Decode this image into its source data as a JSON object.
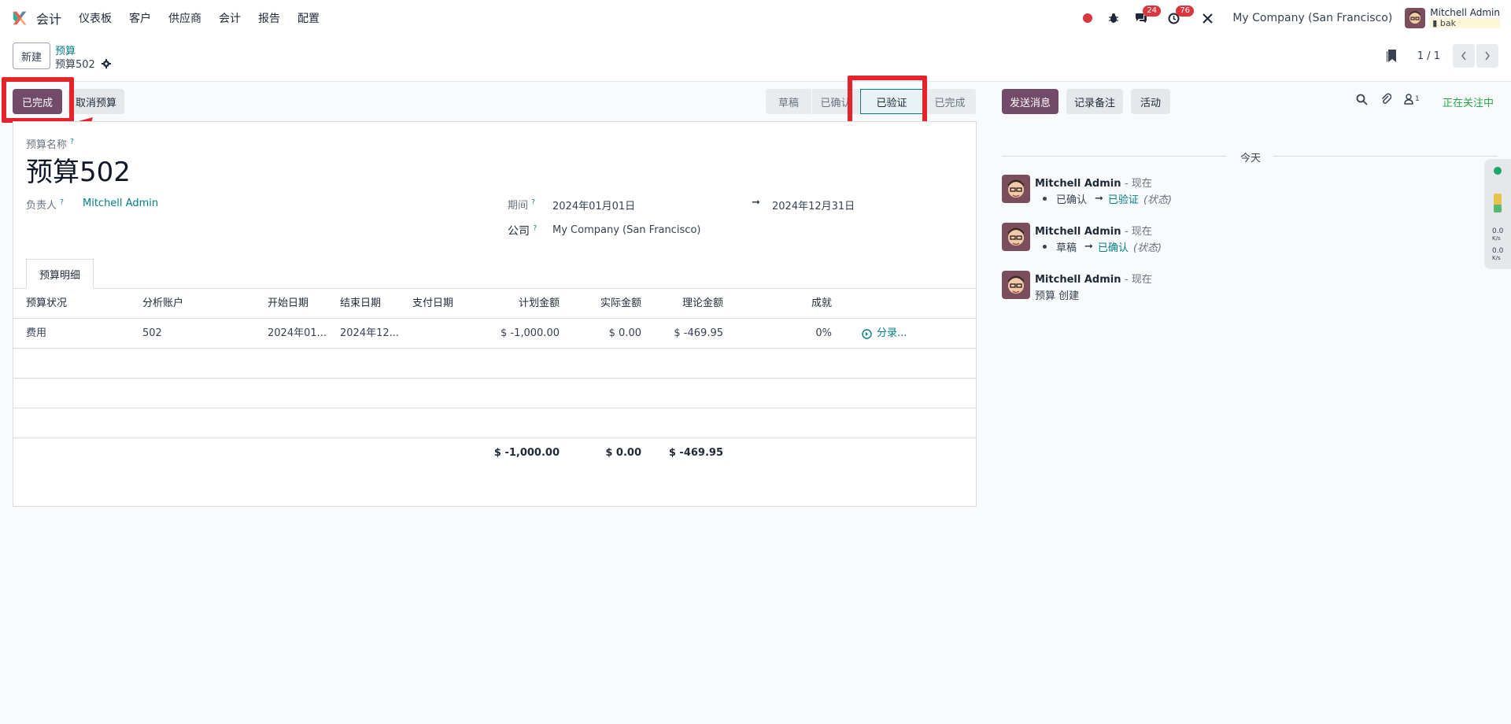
{
  "topnav": {
    "app_title": "会计",
    "menu": [
      "仪表板",
      "客户",
      "供应商",
      "会计",
      "报告",
      "配置"
    ],
    "message_count": "24",
    "activity_count": "76",
    "company": "My Company (San Francisco)",
    "user_name": "Mitchell Admin",
    "db": "bak"
  },
  "control": {
    "new_label": "新建",
    "breadcrumb_parent": "预算",
    "breadcrumb_current": "预算502",
    "pager_value": "1 / 1"
  },
  "statusbar": {
    "done_button": "已完成",
    "cancel_button": "取消预算",
    "stages": [
      "草稿",
      "已确认",
      "已验证",
      "已完成"
    ],
    "active_stage": "已验证"
  },
  "form": {
    "name_label": "预算名称",
    "name_value": "预算502",
    "responsible_label": "负责人",
    "responsible_value": "Mitchell Admin",
    "period_label": "期间",
    "period_start": "2024年01月01日",
    "period_arrow": "➞",
    "period_end": "2024年12月31日",
    "company_label": "公司",
    "company_value": "My Company (San Francisco)",
    "help_mark": "?",
    "tab_label": "预算明细"
  },
  "table": {
    "headers": [
      "预算状况",
      "分析账户",
      "开始日期",
      "结束日期",
      "支付日期",
      "计划金额",
      "实际金额",
      "理论金额",
      "成就"
    ],
    "rows": [
      {
        "position": "费用",
        "account": "502",
        "start": "2024年01...",
        "end": "2024年12...",
        "paid": "",
        "planned": "$ -1,000.00",
        "actual": "$ 0.00",
        "theoretical": "$ -469.95",
        "achievement": "0%",
        "entries": "分录..."
      }
    ],
    "totals": {
      "planned": "$ -1,000.00",
      "actual": "$ 0.00",
      "theoretical": "$ -469.95"
    }
  },
  "chatter": {
    "send_message": "发送消息",
    "log_note": "记录备注",
    "activities": "活动",
    "follower_count": "1",
    "following": "正在关注中",
    "today": "今天",
    "messages": [
      {
        "author": "Mitchell Admin",
        "time": "- 现在",
        "old": "已确认",
        "arrow": "➞",
        "new": "已验证",
        "field": "(状态)"
      },
      {
        "author": "Mitchell Admin",
        "time": "- 现在",
        "old": "草稿",
        "arrow": "➞",
        "new": "已确认",
        "field": "(状态)"
      },
      {
        "author": "Mitchell Admin",
        "time": "- 现在",
        "text": "预算 创建"
      }
    ]
  },
  "side_widget": {
    "up": "0.0",
    "up_unit": "K/s",
    "down": "0.0",
    "down_unit": "K/s"
  },
  "colors": {
    "primary": "#714b67",
    "link": "#017e84",
    "highlight": "#e5232a",
    "following": "#28a745"
  }
}
